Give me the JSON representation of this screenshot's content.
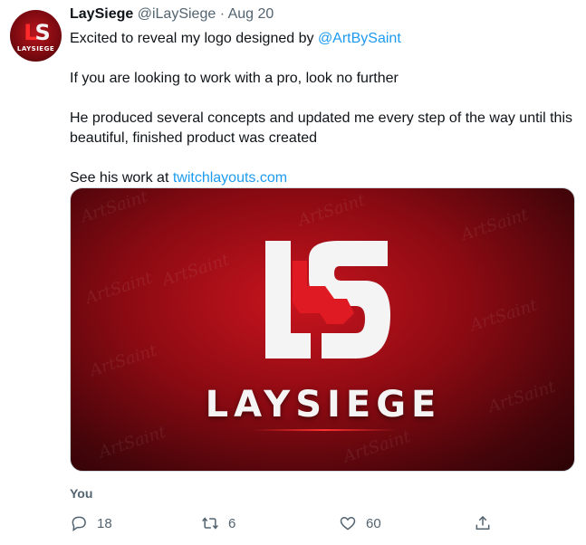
{
  "tweet": {
    "author_name": "LaySiege",
    "handle": "@iLaySiege",
    "separator": "·",
    "date": "Aug 20",
    "line1_prefix": "Excited to reveal my logo designed by ",
    "line1_mention": "@ArtBySaint",
    "line2": "If you are looking to work with a pro, look no further",
    "line3": "He produced several concepts and updated me every step of the way until this beautiful, finished product was created",
    "line4_prefix": "See his work at ",
    "line4_link": "twitchlayouts.com"
  },
  "avatar": {
    "monogram_left": "L",
    "monogram_right": "S",
    "word": "LAYSIEGE"
  },
  "media": {
    "logo_word": "LAYSIEGE",
    "watermark": "ArtSaint"
  },
  "context": {
    "label": "You"
  },
  "actions": {
    "reply_count": "18",
    "retweet_count": "6",
    "like_count": "60"
  },
  "colors": {
    "link": "#1d9bf0",
    "muted": "#536471",
    "brand_red": "#c8141e"
  },
  "icons": [
    "reply-icon",
    "retweet-icon",
    "like-icon",
    "share-icon"
  ]
}
